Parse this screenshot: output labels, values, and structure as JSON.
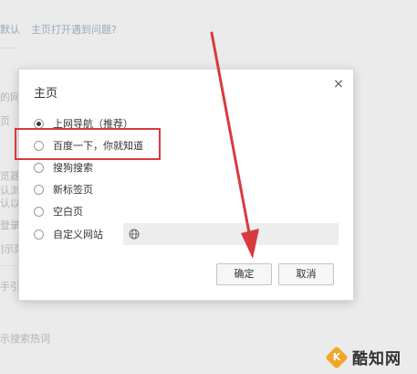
{
  "background": {
    "top_left_text": "默认",
    "top_link_text": "主页打开遇到问题?",
    "left_fragments": [
      "的网",
      "页",
      "览器",
      "认浏",
      "认以",
      "登录",
      "]示菜",
      "手引擎",
      "示搜索热词"
    ]
  },
  "dialog": {
    "title": "主页",
    "close_label": "×",
    "options": [
      {
        "label": "上网导航（推荐）",
        "checked": true
      },
      {
        "label": "百度一下，你就知道",
        "checked": false
      },
      {
        "label": "搜狗搜索",
        "checked": false
      },
      {
        "label": "新标签页",
        "checked": false
      },
      {
        "label": "空白页",
        "checked": false
      },
      {
        "label": "自定义网站",
        "checked": false
      }
    ],
    "custom_url_value": "",
    "ok_label": "确定",
    "cancel_label": "取消"
  },
  "annotation": {
    "highlight_color": "#d93a3f",
    "arrow_color": "#d93a3f"
  },
  "watermark": {
    "logo_letter": "K",
    "text": "酷知网"
  }
}
